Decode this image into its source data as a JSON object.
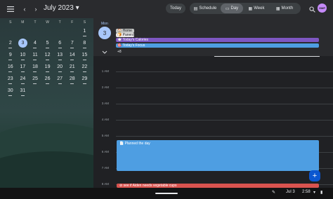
{
  "header": {
    "month_title": "July 2023 ▾",
    "today_label": "Today",
    "views": [
      {
        "label": "Schedule",
        "icon": "schedule-icon",
        "active": false
      },
      {
        "label": "Day",
        "icon": "day-icon",
        "active": true
      },
      {
        "label": "Week",
        "icon": "week-icon",
        "active": false
      },
      {
        "label": "Month",
        "icon": "month-icon",
        "active": false
      }
    ],
    "avatar_text": "GMP"
  },
  "mini_calendar": {
    "weekdays": [
      "S",
      "M",
      "T",
      "W",
      "T",
      "F",
      "S"
    ],
    "weeks": [
      [
        "",
        "",
        "",
        "",
        "",
        "",
        "1"
      ],
      [
        "2",
        "3",
        "4",
        "5",
        "6",
        "7",
        "8"
      ],
      [
        "9",
        "10",
        "11",
        "12",
        "13",
        "14",
        "15"
      ],
      [
        "16",
        "17",
        "18",
        "19",
        "20",
        "21",
        "22"
      ],
      [
        "23",
        "24",
        "25",
        "26",
        "27",
        "28",
        "29"
      ],
      [
        "30",
        "31",
        "",
        "",
        "",
        "",
        ""
      ]
    ],
    "selected_day": "3"
  },
  "day_header": {
    "dow": "Mon",
    "date": "3",
    "all_day_events": [
      {
        "label": "🏠 Home"
      },
      {
        "label": "🍞 Panera"
      },
      {
        "label": "🍽️ Today's Calories"
      },
      {
        "label": "🎯 Today's Focus"
      }
    ],
    "more_label": "+8"
  },
  "time_grid": {
    "hours": [
      "1 AM",
      "2 AM",
      "3 AM",
      "4 AM",
      "5 AM",
      "6 AM",
      "7 AM",
      "8 AM"
    ],
    "events": [
      {
        "label": "📄 Planned the day"
      },
      {
        "label": "⊘ see if Aiden needs vegetable cups"
      }
    ]
  },
  "colors": {
    "accent": "#a8c7fa",
    "calories_chip": "#7e57c2",
    "focus_chip": "#4e9ee2",
    "alert_event": "#d9534f"
  },
  "status_bar": {
    "date": "Jul 3",
    "time": "2:58"
  }
}
